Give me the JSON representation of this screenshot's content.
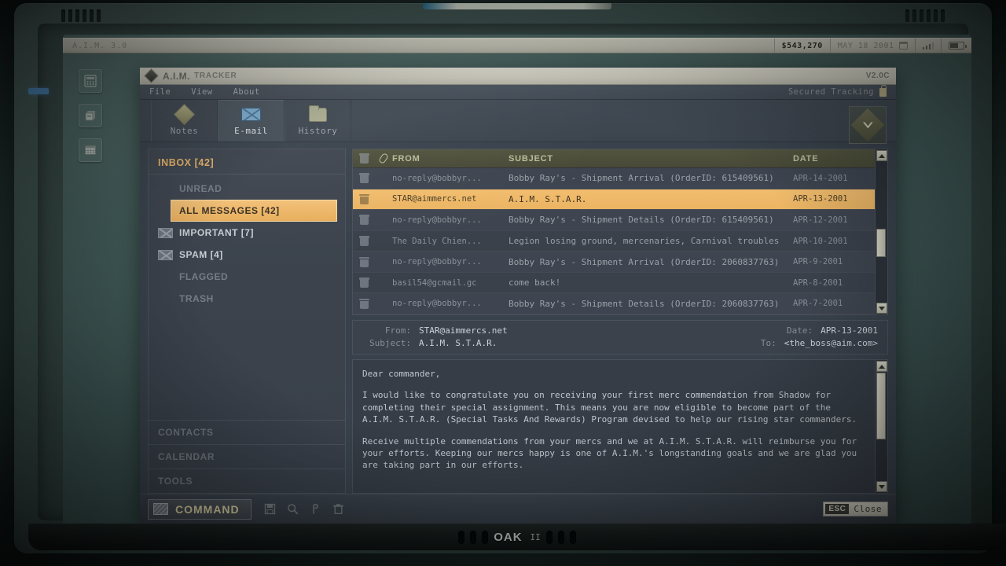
{
  "device": {
    "brand": "OAK",
    "brand_suffix": "II"
  },
  "os_bar": {
    "left_label": "A.I.M. 3.0",
    "money": "$543,270",
    "date": "MAY 18 2001",
    "calendar_icon": "calendar-icon",
    "signal_icon": "signal-bars-icon",
    "battery_icon": "battery-icon"
  },
  "desktop_icons": [
    {
      "name": "calculator-icon"
    },
    {
      "name": "archive-icon"
    },
    {
      "name": "calendar-grid-icon"
    }
  ],
  "app": {
    "logo_icon": "diamond-logo-icon",
    "title": "A.I.M.",
    "subtitle": "TRACKER",
    "version": "V2.0C",
    "menus": [
      "File",
      "View",
      "About"
    ],
    "status_right": "Secured Tracking",
    "lock_icon": "lock-icon",
    "collapse_icon": "chevron-down-icon"
  },
  "tabs": [
    {
      "label": "Notes",
      "icon": "diamond-icon",
      "active": false
    },
    {
      "label": "E-mail",
      "icon": "envelope-icon",
      "active": true
    },
    {
      "label": "History",
      "icon": "folder-icon",
      "active": false
    }
  ],
  "sidebar": {
    "header": "INBOX [42]",
    "items": [
      {
        "label": "UNREAD",
        "envelope": false,
        "selected": false,
        "muted": true
      },
      {
        "label": "ALL MESSAGES [42]",
        "envelope": true,
        "selected": true,
        "muted": false
      },
      {
        "label": "IMPORTANT [7]",
        "envelope": true,
        "selected": false,
        "muted": false
      },
      {
        "label": "SPAM [4]",
        "envelope": true,
        "selected": false,
        "muted": false
      },
      {
        "label": "FLAGGED",
        "envelope": false,
        "selected": false,
        "muted": true
      },
      {
        "label": "TRASH",
        "envelope": false,
        "selected": false,
        "muted": true
      }
    ],
    "footer": [
      "CONTACTS",
      "CALENDAR",
      "TOOLS"
    ]
  },
  "list": {
    "columns": {
      "trash": "",
      "clip": "paperclip-icon",
      "from": "FROM",
      "subject": "SUBJECT",
      "date": "DATE"
    },
    "rows": [
      {
        "from": "no-reply@bobbyr...",
        "subject": "Bobby Ray's - Shipment Arrival (OrderID: 615409561)",
        "date": "APR-14-2001",
        "selected": false
      },
      {
        "from": "STAR@aimmercs.net",
        "subject": "A.I.M. S.T.A.R.",
        "date": "APR-13-2001",
        "selected": true
      },
      {
        "from": "no-reply@bobbyr...",
        "subject": "Bobby Ray's - Shipment Details (OrderID: 615409561)",
        "date": "APR-12-2001",
        "selected": false
      },
      {
        "from": "The Daily Chien...",
        "subject": "Legion losing ground, mercenaries, Carnival troubles",
        "date": "APR-10-2001",
        "selected": false
      },
      {
        "from": "no-reply@bobbyr...",
        "subject": "Bobby Ray's - Shipment Arrival (OrderID: 2060837763)",
        "date": "APR-9-2001",
        "selected": false
      },
      {
        "from": "basil54@gcmail.gc",
        "subject": "come back!",
        "date": "APR-8-2001",
        "selected": false
      },
      {
        "from": "no-reply@bobbyr...",
        "subject": "Bobby Ray's - Shipment Details (OrderID: 2060837763)",
        "date": "APR-7-2001",
        "selected": false
      }
    ],
    "scroll_percent": 60
  },
  "message": {
    "from_label": "From:",
    "from_value": "STAR@aimmercs.net",
    "subject_label": "Subject:",
    "subject_value": "A.I.M. S.T.A.R.",
    "date_label": "Date:",
    "date_value": "APR-13-2001",
    "to_label": "To:",
    "to_value": "<the_boss@aim.com>",
    "body_paragraphs": [
      "Dear commander,",
      "I would like to congratulate you on receiving your first merc commendation from Shadow for completing their special assignment. This means you are now eligible to become part of the A.I.M. S.T.A.R. (Special Tasks And Rewards) Program devised to help our rising star commanders.",
      "Receive multiple commendations from your mercs and we at A.I.M. S.T.A.R. will reimburse you for your efforts. Keeping our mercs happy is one of A.I.M.'s longstanding goals and we are glad you are taking part in our efforts."
    ],
    "scroll_percent": 65
  },
  "footer": {
    "command_label": "COMMAND",
    "command_icon": "command-screen-icon",
    "tools": [
      "save-icon",
      "search-icon",
      "flag-icon",
      "trash-icon"
    ],
    "esc_key": "ESC",
    "close_label": "Close"
  },
  "colors": {
    "accent_amber": "#eab463",
    "panel_dark": "#3b424c",
    "titlebar": "#d4d2c5",
    "header_olive": "#4e5140"
  }
}
